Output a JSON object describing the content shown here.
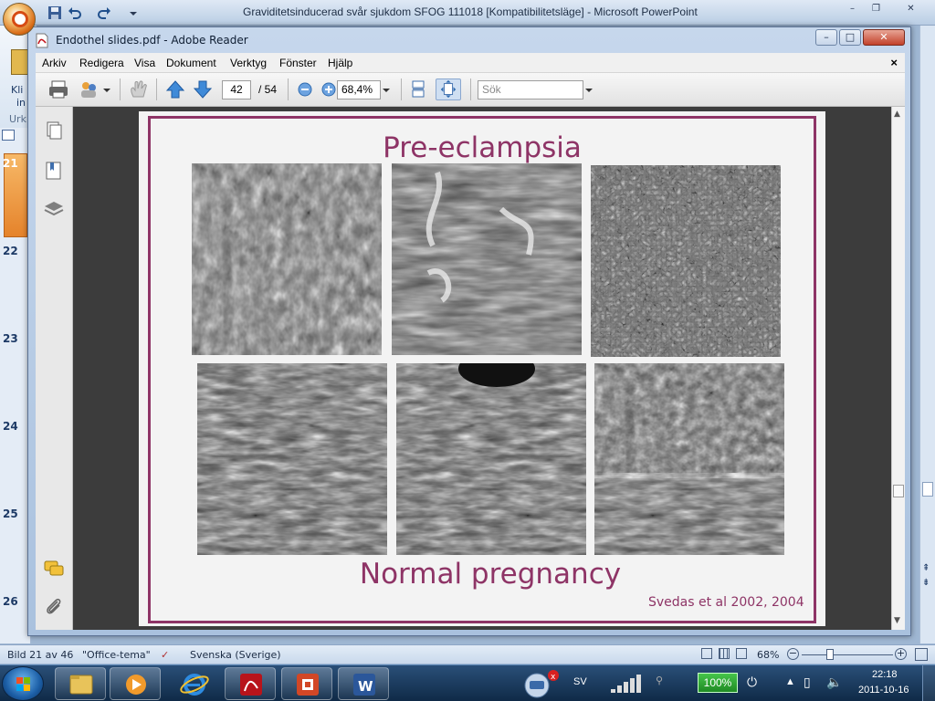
{
  "powerpoint": {
    "title": "Graviditetsinducerad svår sjukdom SFOG 111018 [Kompatibilitetsläge] - Microsoft PowerPoint",
    "ribbon_partial_text": [
      "Kli",
      "in",
      "Urk"
    ],
    "slide_numbers": [
      "21",
      "22",
      "23",
      "24",
      "25",
      "26"
    ],
    "status": {
      "slide_info": "Bild 21 av 46",
      "theme": "\"Office-tema\"",
      "language": "Svenska (Sverige)",
      "zoom": "68%"
    }
  },
  "reader": {
    "title": "Endothel slides.pdf - Adobe Reader",
    "menu": [
      "Arkiv",
      "Redigera",
      "Visa",
      "Dokument",
      "Verktyg",
      "Fönster",
      "Hjälp"
    ],
    "menu_close": "×",
    "toolbar": {
      "page_current": "42",
      "page_total": "/ 54",
      "zoom": "68,4%",
      "search_placeholder": "Sök"
    },
    "window_controls": {
      "minimize": "–",
      "maximize": "□",
      "close": "✕"
    }
  },
  "slide": {
    "title": "Pre-eclampsia",
    "subtitle": "Normal pregnancy",
    "citation": "Svedas et al 2002, 2004",
    "accent_color": "#8e3466",
    "images_top": [
      "micrograph-preeclampsia-1",
      "micrograph-preeclampsia-2",
      "micrograph-preeclampsia-3"
    ],
    "images_bottom": [
      "micrograph-normal-1",
      "micrograph-normal-2",
      "micrograph-normal-3"
    ]
  },
  "taskbar": {
    "apps": [
      "explorer",
      "media-player",
      "internet-explorer",
      "adobe-reader",
      "powerpoint",
      "word"
    ],
    "language": "SV",
    "battery": "100%",
    "time": "22:18",
    "date": "2011-10-16"
  }
}
